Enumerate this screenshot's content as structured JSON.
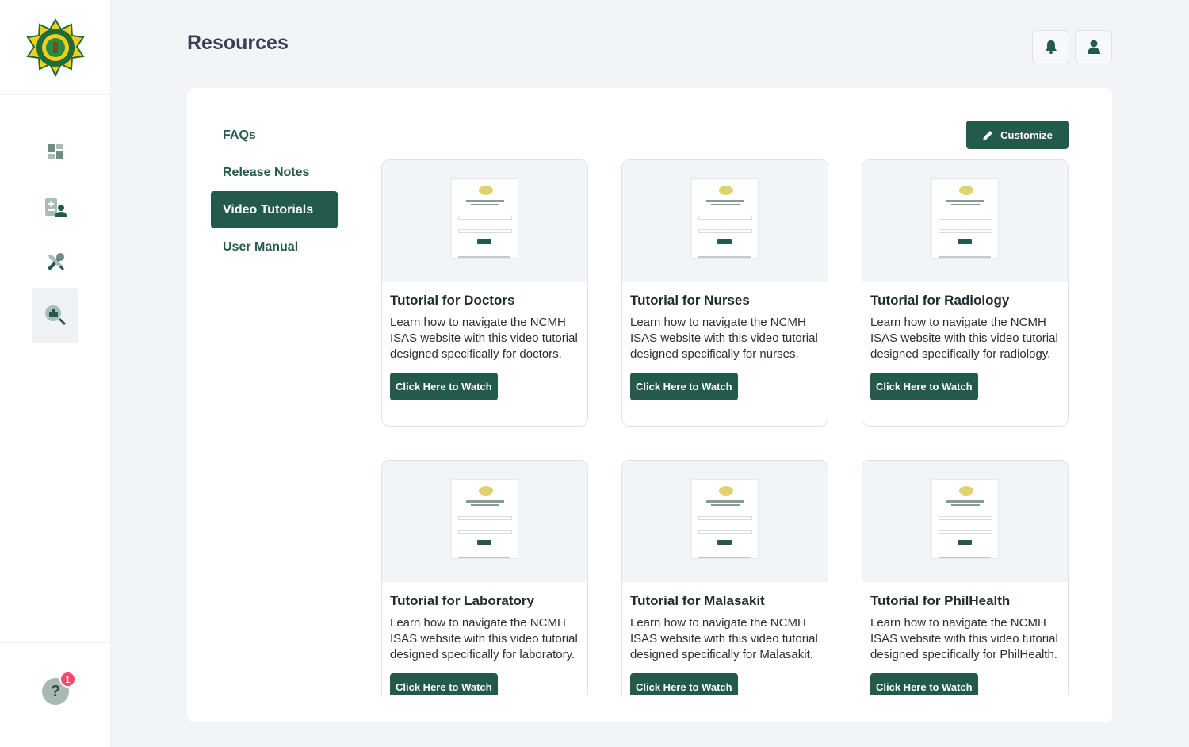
{
  "page": {
    "title": "Resources"
  },
  "sidebar": {
    "items": [
      {
        "name": "dashboard-icon"
      },
      {
        "name": "patient-records-icon"
      },
      {
        "name": "tools-icon"
      },
      {
        "name": "analytics-search-icon",
        "active": true
      }
    ],
    "help_badge": "1"
  },
  "header": {
    "notification_icon": "bell-icon",
    "profile_icon": "user-icon"
  },
  "tabs": [
    {
      "label": "FAQs"
    },
    {
      "label": "Release Notes"
    },
    {
      "label": "Video Tutorials",
      "active": true
    },
    {
      "label": "User Manual"
    }
  ],
  "customize_label": "Customize",
  "cards": [
    {
      "title": "Tutorial for Doctors",
      "description": "Learn how to navigate the NCMH ISAS website with this  video tutorial designed specifically for doctors.",
      "button": "Click Here to Watch"
    },
    {
      "title": "Tutorial for Nurses",
      "description": "Learn how to navigate the NCMH ISAS website with this  video tutorial designed specifically for nurses.",
      "button": "Click Here to Watch"
    },
    {
      "title": "Tutorial for Radiology",
      "description": "Learn how to navigate the NCMH ISAS website with this  video tutorial designed specifically for radiology.",
      "button": "Click Here to Watch"
    },
    {
      "title": "Tutorial for Laboratory",
      "description": "Learn how to navigate the NCMH ISAS website with this  video tutorial designed specifically for laboratory.",
      "button": "Click Here to Watch"
    },
    {
      "title": "Tutorial for Malasakit",
      "description": "Learn how to navigate the NCMH ISAS website with this  video tutorial designed specifically for Malasakit.",
      "button": "Click Here to Watch"
    },
    {
      "title": "Tutorial for PhilHealth",
      "description": "Learn how to navigate the NCMH ISAS website with this  video tutorial designed specifically for PhilHealth.",
      "button": "Click Here to Watch"
    }
  ],
  "colors": {
    "primary": "#245a4b",
    "background": "#f2f5f8",
    "badge": "#ef4b6c",
    "title": "#3d3e55"
  }
}
